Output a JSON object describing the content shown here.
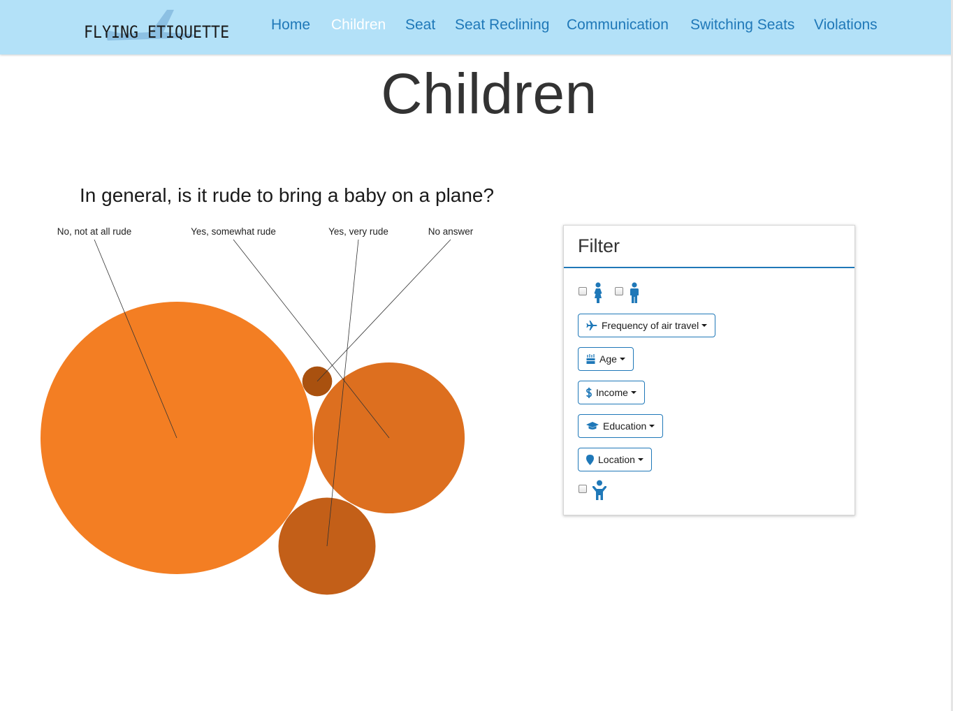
{
  "brand": {
    "logo_text": "FLYING ETIQUETTE"
  },
  "nav": {
    "items": [
      {
        "label": "Home",
        "active": false
      },
      {
        "label": "Children",
        "active": true
      },
      {
        "label": "Seat",
        "active": false
      },
      {
        "label": "Seat Reclining",
        "active": false
      },
      {
        "label": "Communication",
        "active": false
      },
      {
        "label": "Switching Seats",
        "active": false
      },
      {
        "label": "Violations",
        "active": false
      }
    ]
  },
  "page": {
    "title": "Children"
  },
  "question": "In general, is it rude to bring a baby on a plane?",
  "chart_data": {
    "type": "bubble",
    "bubbles": [
      {
        "label": "No, not at all rude",
        "relative_area": 100,
        "color": "#f37e23"
      },
      {
        "label": "Yes, somewhat rude",
        "relative_area": 30.7,
        "color": "#dd6f1f"
      },
      {
        "label": "Yes, very rude",
        "relative_area": 12.7,
        "color": "#c35f18"
      },
      {
        "label": "No answer",
        "relative_area": 1.2,
        "color": "#a9510f"
      }
    ]
  },
  "filter": {
    "title": "Filter",
    "gender_options": [
      {
        "icon": "female-icon",
        "checked": false
      },
      {
        "icon": "male-icon",
        "checked": false
      }
    ],
    "dropdowns": [
      {
        "label": "Frequency of air travel",
        "icon": "plane-icon"
      },
      {
        "label": "Age",
        "icon": "birthday-cake-icon"
      },
      {
        "label": "Income",
        "icon": "dollar-icon"
      },
      {
        "label": "Education",
        "icon": "graduation-cap-icon"
      },
      {
        "label": "Location",
        "icon": "map-marker-icon"
      }
    ],
    "child_option": {
      "icon": "child-icon",
      "checked": false
    }
  },
  "colors": {
    "navbar": "#b3e1f8",
    "link": "#1f78b8",
    "active_link": "#ffffff",
    "accent": "#1f78b8"
  }
}
